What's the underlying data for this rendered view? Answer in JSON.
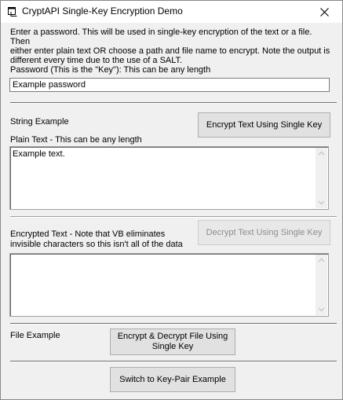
{
  "window": {
    "title": "CryptAPI Single-Key Encryption Demo",
    "close_glyph": "✕"
  },
  "intro_text": "Enter a password.  This will be used in single-key encryption of the text or a file.  Then\neither enter plain text OR choose a path and file name to encrypt.  Note the output is\ndifferent every time due to the use of a SALT.",
  "password": {
    "label": "Password (This is the \"Key\"): This can be any length",
    "value": "Example password"
  },
  "string_section": {
    "heading": "String Example",
    "encrypt_button": "Encrypt Text Using Single Key",
    "plain_label": "Plain Text - This can be any length",
    "plain_value": "Example text.",
    "encrypted_label_line1": "Encrypted Text - Note that VB eliminates",
    "encrypted_label_line2": "invisible characters so this isn't all of the data",
    "decrypt_button": "Decrypt Text Using Single Key",
    "decrypt_button_state": "disabled",
    "encrypted_value": ""
  },
  "file_section": {
    "heading": "File Example",
    "button_line1": "Encrypt & Decrypt File Using",
    "button_line2": "Single Key"
  },
  "switch_button": "Switch to Key-Pair Example",
  "icons": {
    "app": "app-window-icon",
    "close": "close-icon",
    "scroll_up": "scroll-up-arrow-icon",
    "scroll_down": "scroll-down-arrow-icon"
  },
  "colors": {
    "face": "#f0f0f0",
    "button": "#e1e1e1",
    "disabled_text": "#8d8d8d"
  }
}
